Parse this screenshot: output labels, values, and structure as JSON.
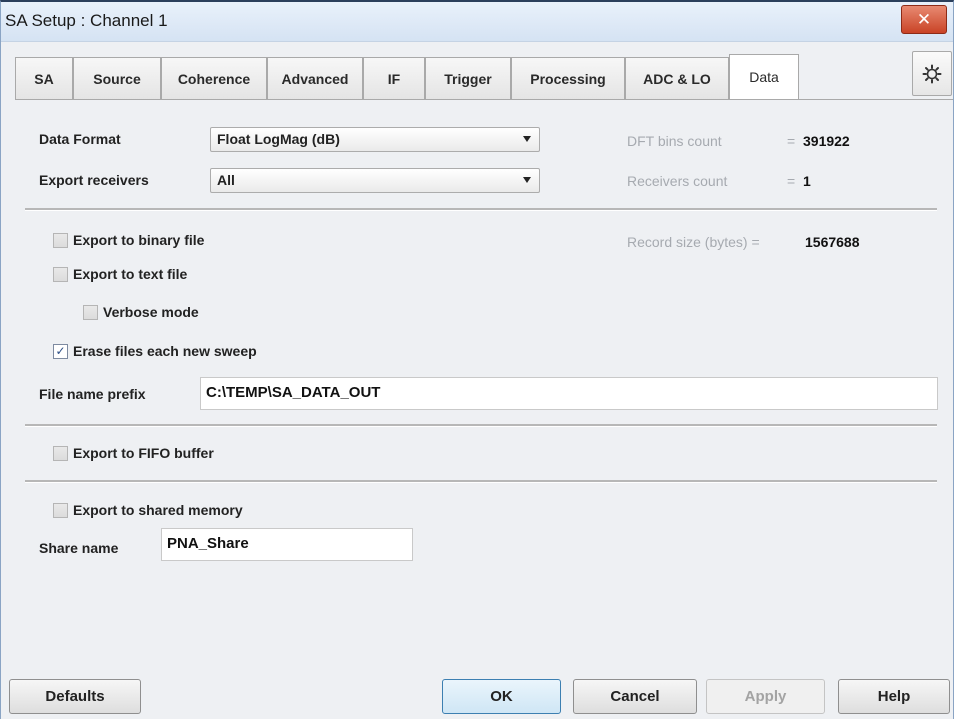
{
  "window": {
    "title": "SA Setup : Channel 1",
    "close_label": "✕"
  },
  "tabs": [
    {
      "label": "SA",
      "active": false
    },
    {
      "label": "Source",
      "active": false
    },
    {
      "label": "Coherence",
      "active": false
    },
    {
      "label": "Advanced",
      "active": false
    },
    {
      "label": "IF",
      "active": false
    },
    {
      "label": "Trigger",
      "active": false
    },
    {
      "label": "Processing",
      "active": false
    },
    {
      "label": "ADC & LO",
      "active": false
    },
    {
      "label": "Data",
      "active": true
    }
  ],
  "gear_icon": "gear-icon",
  "data_format": {
    "label": "Data Format",
    "value": "Float LogMag (dB)"
  },
  "export_receivers": {
    "label": "Export receivers",
    "value": "All"
  },
  "info": {
    "dft_bins": {
      "label": "DFT bins count",
      "eq": "=",
      "value": "391922"
    },
    "receivers": {
      "label": "Receivers count",
      "eq": "=",
      "value": "1"
    },
    "record_size": {
      "label": "Record size (bytes) =",
      "value": "1567688"
    }
  },
  "checkboxes": {
    "binary": {
      "label": "Export to binary file",
      "checked": false
    },
    "text": {
      "label": "Export to text file",
      "checked": false
    },
    "verbose": {
      "label": "Verbose mode",
      "checked": false
    },
    "erase": {
      "label": "Erase files each new sweep",
      "checked": true
    },
    "fifo": {
      "label": "Export to FIFO buffer",
      "checked": false
    },
    "shared": {
      "label": "Export to shared memory",
      "checked": false
    }
  },
  "check_mark": "✓",
  "file_prefix": {
    "label": "File name prefix",
    "value": "C:\\TEMP\\SA_DATA_OUT"
  },
  "share_name": {
    "label": "Share name",
    "value": "PNA_Share"
  },
  "buttons": {
    "defaults": "Defaults",
    "ok": "OK",
    "cancel": "Cancel",
    "apply": "Apply",
    "help": "Help"
  }
}
